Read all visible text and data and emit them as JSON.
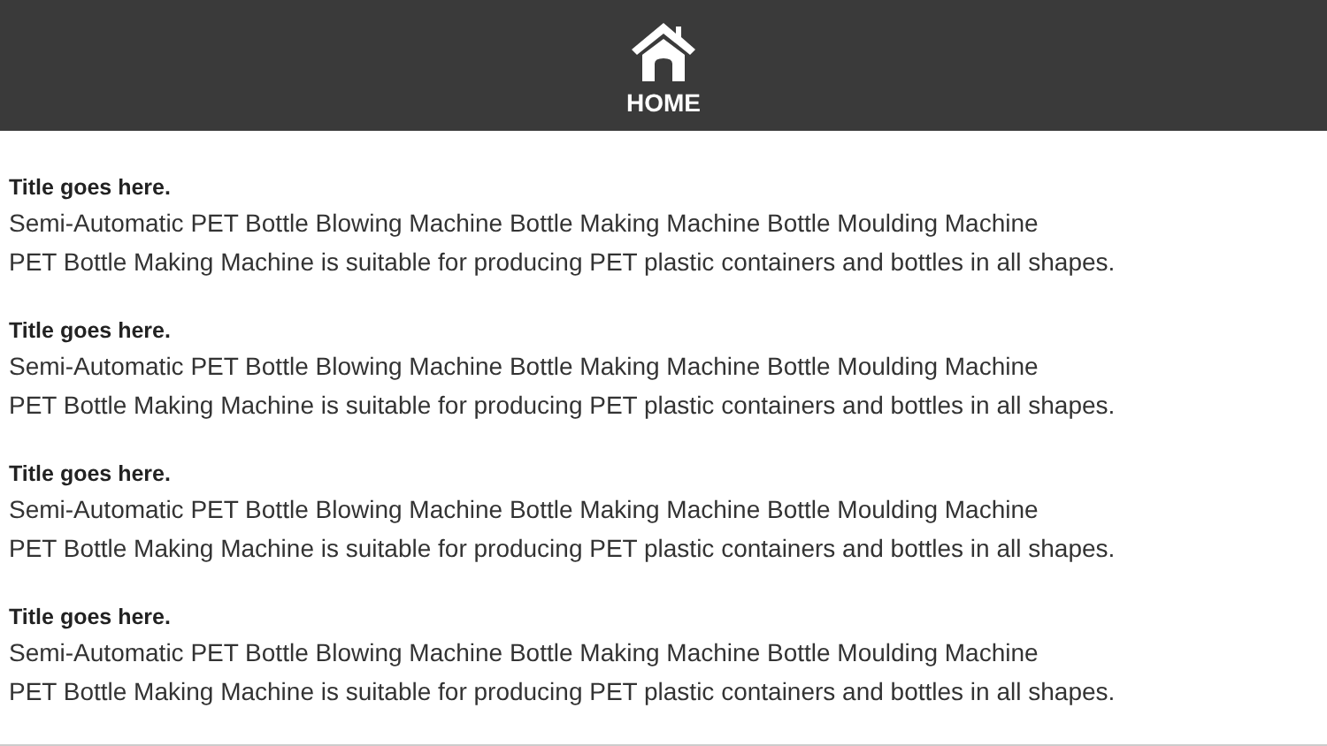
{
  "header": {
    "home_label": "HOME"
  },
  "items": [
    {
      "title": "Title goes here.",
      "lines": [
        "Semi-Automatic PET Bottle Blowing Machine Bottle Making Machine Bottle Moulding Machine",
        "PET Bottle Making Machine is suitable for producing PET plastic containers and bottles in all shapes."
      ]
    },
    {
      "title": "Title goes here.",
      "lines": [
        "Semi-Automatic PET Bottle Blowing Machine Bottle Making Machine Bottle Moulding Machine",
        "PET Bottle Making Machine is suitable for producing PET plastic containers and bottles in all shapes."
      ]
    },
    {
      "title": "Title goes here.",
      "lines": [
        "Semi-Automatic PET Bottle Blowing Machine Bottle Making Machine Bottle Moulding Machine",
        "PET Bottle Making Machine is suitable for producing PET plastic containers and bottles in all shapes."
      ]
    },
    {
      "title": "Title goes here.",
      "lines": [
        "Semi-Automatic PET Bottle Blowing Machine Bottle Making Machine Bottle Moulding Machine",
        "PET Bottle Making Machine is suitable for producing PET plastic containers and bottles in all shapes."
      ]
    }
  ]
}
